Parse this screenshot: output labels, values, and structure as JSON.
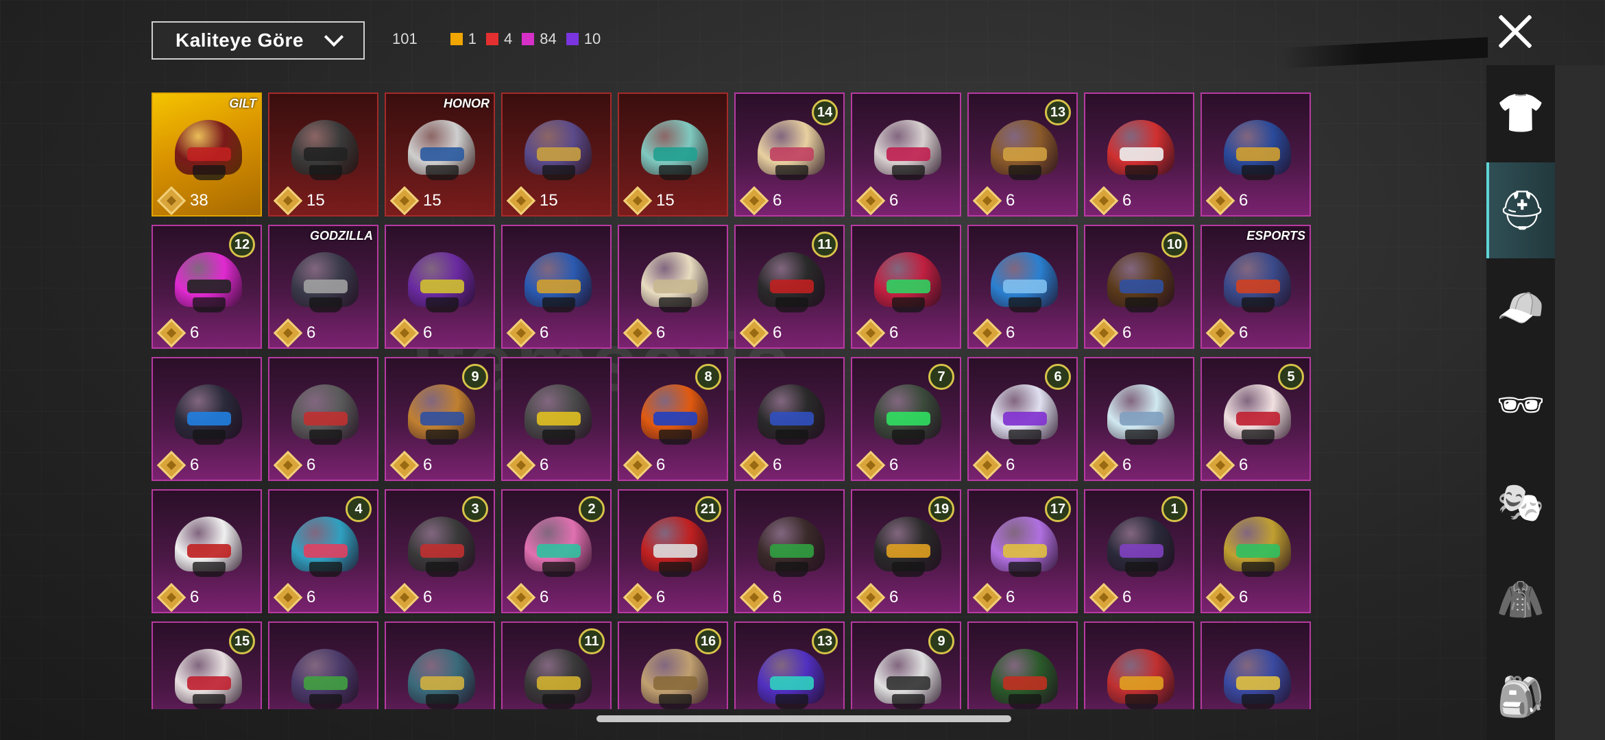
{
  "filter": {
    "label": "Kaliteye Göre"
  },
  "counts": {
    "total": "101",
    "tiers": [
      {
        "value": "1",
        "color": "#f0a500"
      },
      {
        "value": "4",
        "color": "#e43030"
      },
      {
        "value": "84",
        "color": "#d630c8"
      },
      {
        "value": "10",
        "color": "#7a35e0"
      }
    ]
  },
  "sidebar": [
    {
      "name": "outfit-icon",
      "glyph": "👕",
      "active": false
    },
    {
      "name": "helmet-icon",
      "glyph": "⛑",
      "active": true
    },
    {
      "name": "hat-icon",
      "glyph": "🧢",
      "active": false
    },
    {
      "name": "glasses-icon",
      "glyph": "🕶",
      "active": false
    },
    {
      "name": "mask-icon",
      "glyph": "🎭",
      "active": false
    },
    {
      "name": "jacket-icon",
      "glyph": "🧥",
      "active": false
    },
    {
      "name": "backpack-icon",
      "glyph": "🎒",
      "active": false
    }
  ],
  "items": [
    {
      "tier": "gold",
      "price": "38",
      "brand": "GILT",
      "color": "#7a1a1a",
      "visor": "#c02020"
    },
    {
      "tier": "red",
      "price": "15",
      "color": "#3a3a3a",
      "visor": "#222"
    },
    {
      "tier": "red",
      "price": "15",
      "brand": "HONOR",
      "color": "#cfcfcf",
      "visor": "#2a5aa0"
    },
    {
      "tier": "red",
      "price": "15",
      "color": "#5a4a8a",
      "visor": "#c8a040"
    },
    {
      "tier": "red",
      "price": "15",
      "color": "#7fc9c0",
      "visor": "#20a090"
    },
    {
      "tier": "purple",
      "price": "6",
      "badge": "14",
      "color": "#e8d0a0",
      "visor": "#c04060"
    },
    {
      "tier": "purple",
      "price": "6",
      "color": "#d8d0d0",
      "visor": "#c02050"
    },
    {
      "tier": "purple",
      "price": "6",
      "badge": "13",
      "color": "#8a5a2a",
      "visor": "#d0a040"
    },
    {
      "tier": "purple",
      "price": "6",
      "color": "#d03030",
      "visor": "#eee"
    },
    {
      "tier": "purple",
      "price": "6",
      "color": "#2a4a9a",
      "visor": "#d0a030"
    },
    {
      "tier": "purple",
      "price": "6",
      "badge": "12",
      "color": "#e02ad0",
      "visor": "#222"
    },
    {
      "tier": "purple",
      "price": "6",
      "brand": "GODZILLA",
      "color": "#3a3a4a",
      "visor": "#a0a0a0"
    },
    {
      "tier": "purple",
      "price": "6",
      "color": "#6a2aa0",
      "visor": "#d0c030"
    },
    {
      "tier": "purple",
      "price": "6",
      "color": "#2a5ab0",
      "visor": "#d0a030"
    },
    {
      "tier": "purple",
      "price": "6",
      "color": "#e8dcc0",
      "visor": "#c8b890"
    },
    {
      "tier": "purple",
      "price": "6",
      "badge": "11",
      "color": "#2a2a2a",
      "visor": "#c02020"
    },
    {
      "tier": "purple",
      "price": "6",
      "color": "#c02040",
      "visor": "#30d060"
    },
    {
      "tier": "purple",
      "price": "6",
      "color": "#2a80d0",
      "visor": "#80c0f0"
    },
    {
      "tier": "purple",
      "price": "6",
      "badge": "10",
      "color": "#5a3a1a",
      "visor": "#3050a0"
    },
    {
      "tier": "purple",
      "price": "6",
      "brand": "ESPORTS",
      "color": "#3a4a8a",
      "visor": "#d04020"
    },
    {
      "tier": "purple",
      "price": "6",
      "color": "#2a2a3a",
      "visor": "#2080e0"
    },
    {
      "tier": "purple",
      "price": "6",
      "color": "#5a5a5a",
      "visor": "#c03030"
    },
    {
      "tier": "purple",
      "price": "6",
      "badge": "9",
      "color": "#c08030",
      "visor": "#3050a0"
    },
    {
      "tier": "purple",
      "price": "6",
      "color": "#4a4a4a",
      "visor": "#e0c020"
    },
    {
      "tier": "purple",
      "price": "6",
      "badge": "8",
      "color": "#e05a10",
      "visor": "#2040c0"
    },
    {
      "tier": "purple",
      "price": "6",
      "color": "#2a2a2a",
      "visor": "#3050c0"
    },
    {
      "tier": "purple",
      "price": "6",
      "badge": "7",
      "color": "#3a4a3a",
      "visor": "#30e060"
    },
    {
      "tier": "purple",
      "price": "6",
      "badge": "6",
      "color": "#e0e0f0",
      "visor": "#8030d0"
    },
    {
      "tier": "purple",
      "price": "6",
      "color": "#d0e8f0",
      "visor": "#80a0c0"
    },
    {
      "tier": "purple",
      "price": "6",
      "badge": "5",
      "color": "#f0e0e0",
      "visor": "#c02030"
    },
    {
      "tier": "purple",
      "price": "6",
      "color": "#f0f0f0",
      "visor": "#c02020"
    },
    {
      "tier": "purple",
      "price": "6",
      "badge": "4",
      "color": "#30a0c0",
      "visor": "#e04060"
    },
    {
      "tier": "purple",
      "price": "6",
      "badge": "3",
      "color": "#3a3a3a",
      "visor": "#c03030"
    },
    {
      "tier": "purple",
      "price": "6",
      "badge": "2",
      "color": "#e070b0",
      "visor": "#30c0a0"
    },
    {
      "tier": "purple",
      "price": "6",
      "badge": "21",
      "color": "#c02020",
      "visor": "#ddd"
    },
    {
      "tier": "purple",
      "price": "6",
      "color": "#3a2a2a",
      "visor": "#30a040"
    },
    {
      "tier": "purple",
      "price": "6",
      "badge": "19",
      "color": "#2a2a2a",
      "visor": "#e0a020"
    },
    {
      "tier": "purple",
      "price": "6",
      "badge": "17",
      "color": "#b070e0",
      "visor": "#e0c040"
    },
    {
      "tier": "purple",
      "price": "6",
      "badge": "1",
      "color": "#2a2a3a",
      "visor": "#8040c0"
    },
    {
      "tier": "purple",
      "price": "6",
      "color": "#c0a030",
      "visor": "#30c060"
    },
    {
      "tier": "purple",
      "price": "",
      "badge": "15",
      "color": "#e8e0e0",
      "visor": "#c02030"
    },
    {
      "tier": "purple",
      "price": "",
      "color": "#4a3a6a",
      "visor": "#40a040"
    },
    {
      "tier": "purple",
      "price": "",
      "color": "#3a6a7a",
      "visor": "#d0b040"
    },
    {
      "tier": "purple",
      "price": "",
      "badge": "11",
      "color": "#3a3a3a",
      "visor": "#d0b030"
    },
    {
      "tier": "purple",
      "price": "",
      "badge": "16",
      "color": "#c0a070",
      "visor": "#8a6a3a"
    },
    {
      "tier": "purple",
      "price": "",
      "badge": "13",
      "color": "#5030c0",
      "visor": "#30d0c0"
    },
    {
      "tier": "purple",
      "price": "",
      "badge": "9",
      "color": "#e0e0e0",
      "visor": "#333"
    },
    {
      "tier": "purple",
      "price": "",
      "color": "#2a5a2a",
      "visor": "#c03020"
    },
    {
      "tier": "purple",
      "price": "",
      "color": "#c03030",
      "visor": "#e0a020"
    },
    {
      "tier": "purple",
      "price": "",
      "color": "#3a4aa0",
      "visor": "#e0c040"
    }
  ]
}
